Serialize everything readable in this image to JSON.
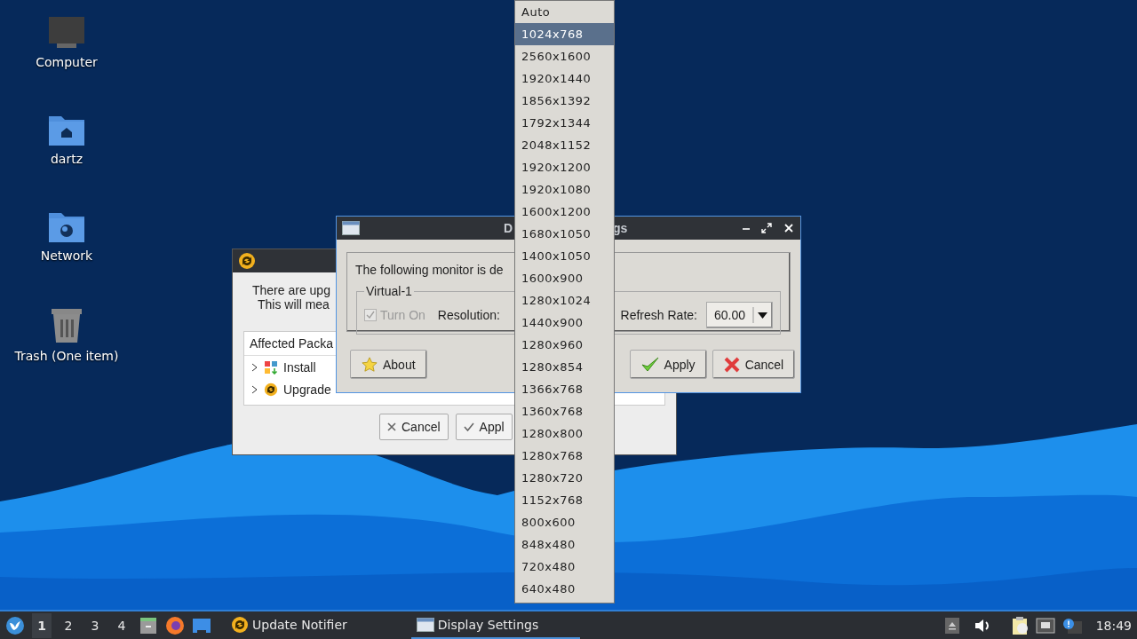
{
  "desktop_icons": [
    {
      "label": "Computer",
      "kind": "computer"
    },
    {
      "label": "dartz",
      "kind": "home"
    },
    {
      "label": "Network",
      "kind": "network"
    },
    {
      "label": "Trash (One item)",
      "kind": "trash"
    }
  ],
  "update_window": {
    "message_lines": [
      "There are upg",
      "This will mea"
    ],
    "packages": {
      "header": "Affected Packa",
      "items": [
        {
          "label": "Install",
          "kind": "install",
          "expanded": false
        },
        {
          "label": "Upgrade",
          "kind": "upgrade",
          "expanded": false
        }
      ]
    },
    "buttons": [
      {
        "label": "Cancel",
        "kind": "cancel"
      },
      {
        "label": "Appl",
        "kind": "apply"
      }
    ]
  },
  "display_window": {
    "title_parts": [
      "D",
      "gs"
    ],
    "message": "The following monitor is de",
    "monitor": {
      "name": "Virtual-1",
      "turn_on": {
        "label": "Turn On",
        "checked": true,
        "disabled": true
      },
      "resolution_label": "Resolution:",
      "refresh_label": "Refresh Rate:",
      "refresh_value": "60.00"
    },
    "buttons": [
      {
        "label": "About",
        "kind": "about"
      },
      {
        "label": "Apply",
        "kind": "apply"
      },
      {
        "label": "Cancel",
        "kind": "cancel"
      }
    ]
  },
  "resolution_menu": [
    {
      "label": "Auto",
      "selected": false
    },
    {
      "label": "1024x768",
      "selected": true
    },
    {
      "label": "2560x1600",
      "selected": false
    },
    {
      "label": "1920x1440",
      "selected": false
    },
    {
      "label": "1856x1392",
      "selected": false
    },
    {
      "label": "1792x1344",
      "selected": false
    },
    {
      "label": "2048x1152",
      "selected": false
    },
    {
      "label": "1920x1200",
      "selected": false
    },
    {
      "label": "1920x1080",
      "selected": false
    },
    {
      "label": "1600x1200",
      "selected": false
    },
    {
      "label": "1680x1050",
      "selected": false
    },
    {
      "label": "1400x1050",
      "selected": false
    },
    {
      "label": "1600x900",
      "selected": false
    },
    {
      "label": "1280x1024",
      "selected": false
    },
    {
      "label": "1440x900",
      "selected": false
    },
    {
      "label": "1280x960",
      "selected": false
    },
    {
      "label": "1280x854",
      "selected": false
    },
    {
      "label": "1366x768",
      "selected": false
    },
    {
      "label": "1360x768",
      "selected": false
    },
    {
      "label": "1280x800",
      "selected": false
    },
    {
      "label": "1280x768",
      "selected": false
    },
    {
      "label": "1280x720",
      "selected": false
    },
    {
      "label": "1152x768",
      "selected": false
    },
    {
      "label": "800x600",
      "selected": false
    },
    {
      "label": "848x480",
      "selected": false
    },
    {
      "label": "720x480",
      "selected": false
    },
    {
      "label": "640x480",
      "selected": false
    }
  ],
  "taskbar": {
    "workspaces": [
      {
        "label": "1",
        "selected": true
      },
      {
        "label": "2",
        "selected": false
      },
      {
        "label": "3",
        "selected": false
      },
      {
        "label": "4",
        "selected": false
      }
    ],
    "tasks": [
      {
        "label": "Update Notifier",
        "kind": "updater",
        "active": false
      },
      {
        "label": "Display Settings",
        "kind": "window",
        "active": true
      }
    ],
    "clock": "18:49"
  }
}
